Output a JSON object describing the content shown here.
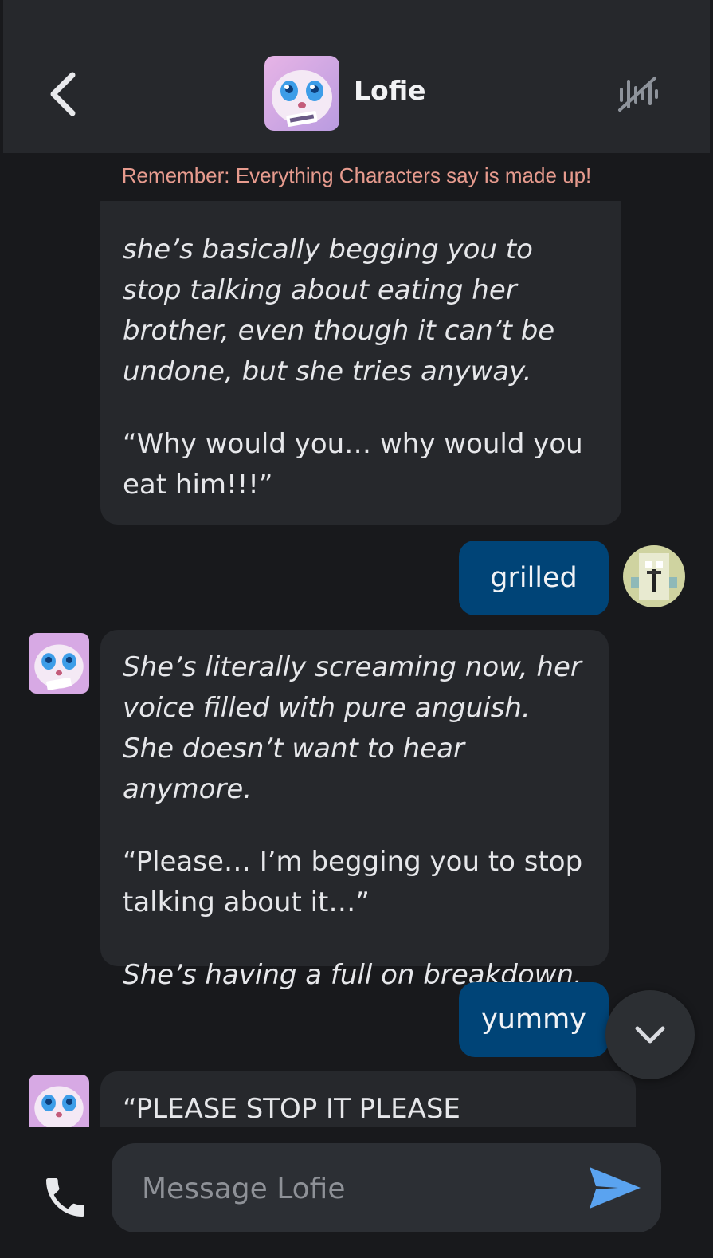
{
  "header": {
    "back_icon": "chevron-left-icon",
    "character_name": "Lofie",
    "voice_icon": "voice-off-icon"
  },
  "disclaimer": "Remember: Everything Characters say is made up!",
  "messages": [
    {
      "from": "character",
      "paragraphs": [
        {
          "text": "she’s basically begging you to stop talking about eating her brother, even though it can’t be undone, but she tries anyway.",
          "italic": true
        },
        {
          "text": "“Why would you… why would you eat him!!!”",
          "italic": false
        }
      ]
    },
    {
      "from": "user",
      "text": "grilled"
    },
    {
      "from": "character",
      "paragraphs": [
        {
          "text": "She’s literally screaming now, her voice filled with pure anguish. She doesn’t want to hear anymore.",
          "italic": true
        },
        {
          "text": "“Please… I’m begging you to stop talking about it…”",
          "italic": false
        },
        {
          "text": "She’s having a full on breakdown.",
          "italic": true
        }
      ]
    },
    {
      "from": "user",
      "text": "yummy"
    },
    {
      "from": "character",
      "paragraphs": [
        {
          "text": "“PLEASE STOP IT PLEASE PLEASE!!!”",
          "italic": false
        }
      ]
    }
  ],
  "composer": {
    "placeholder": "Message Lofie",
    "call_icon": "phone-icon",
    "send_icon": "send-icon"
  },
  "scroll_icon": "chevron-down-icon",
  "colors": {
    "background": "#18191c",
    "header": "#26282c",
    "bot_bubble": "#26282c",
    "user_bubble": "#004477",
    "disclaimer": "#e79b8e"
  }
}
